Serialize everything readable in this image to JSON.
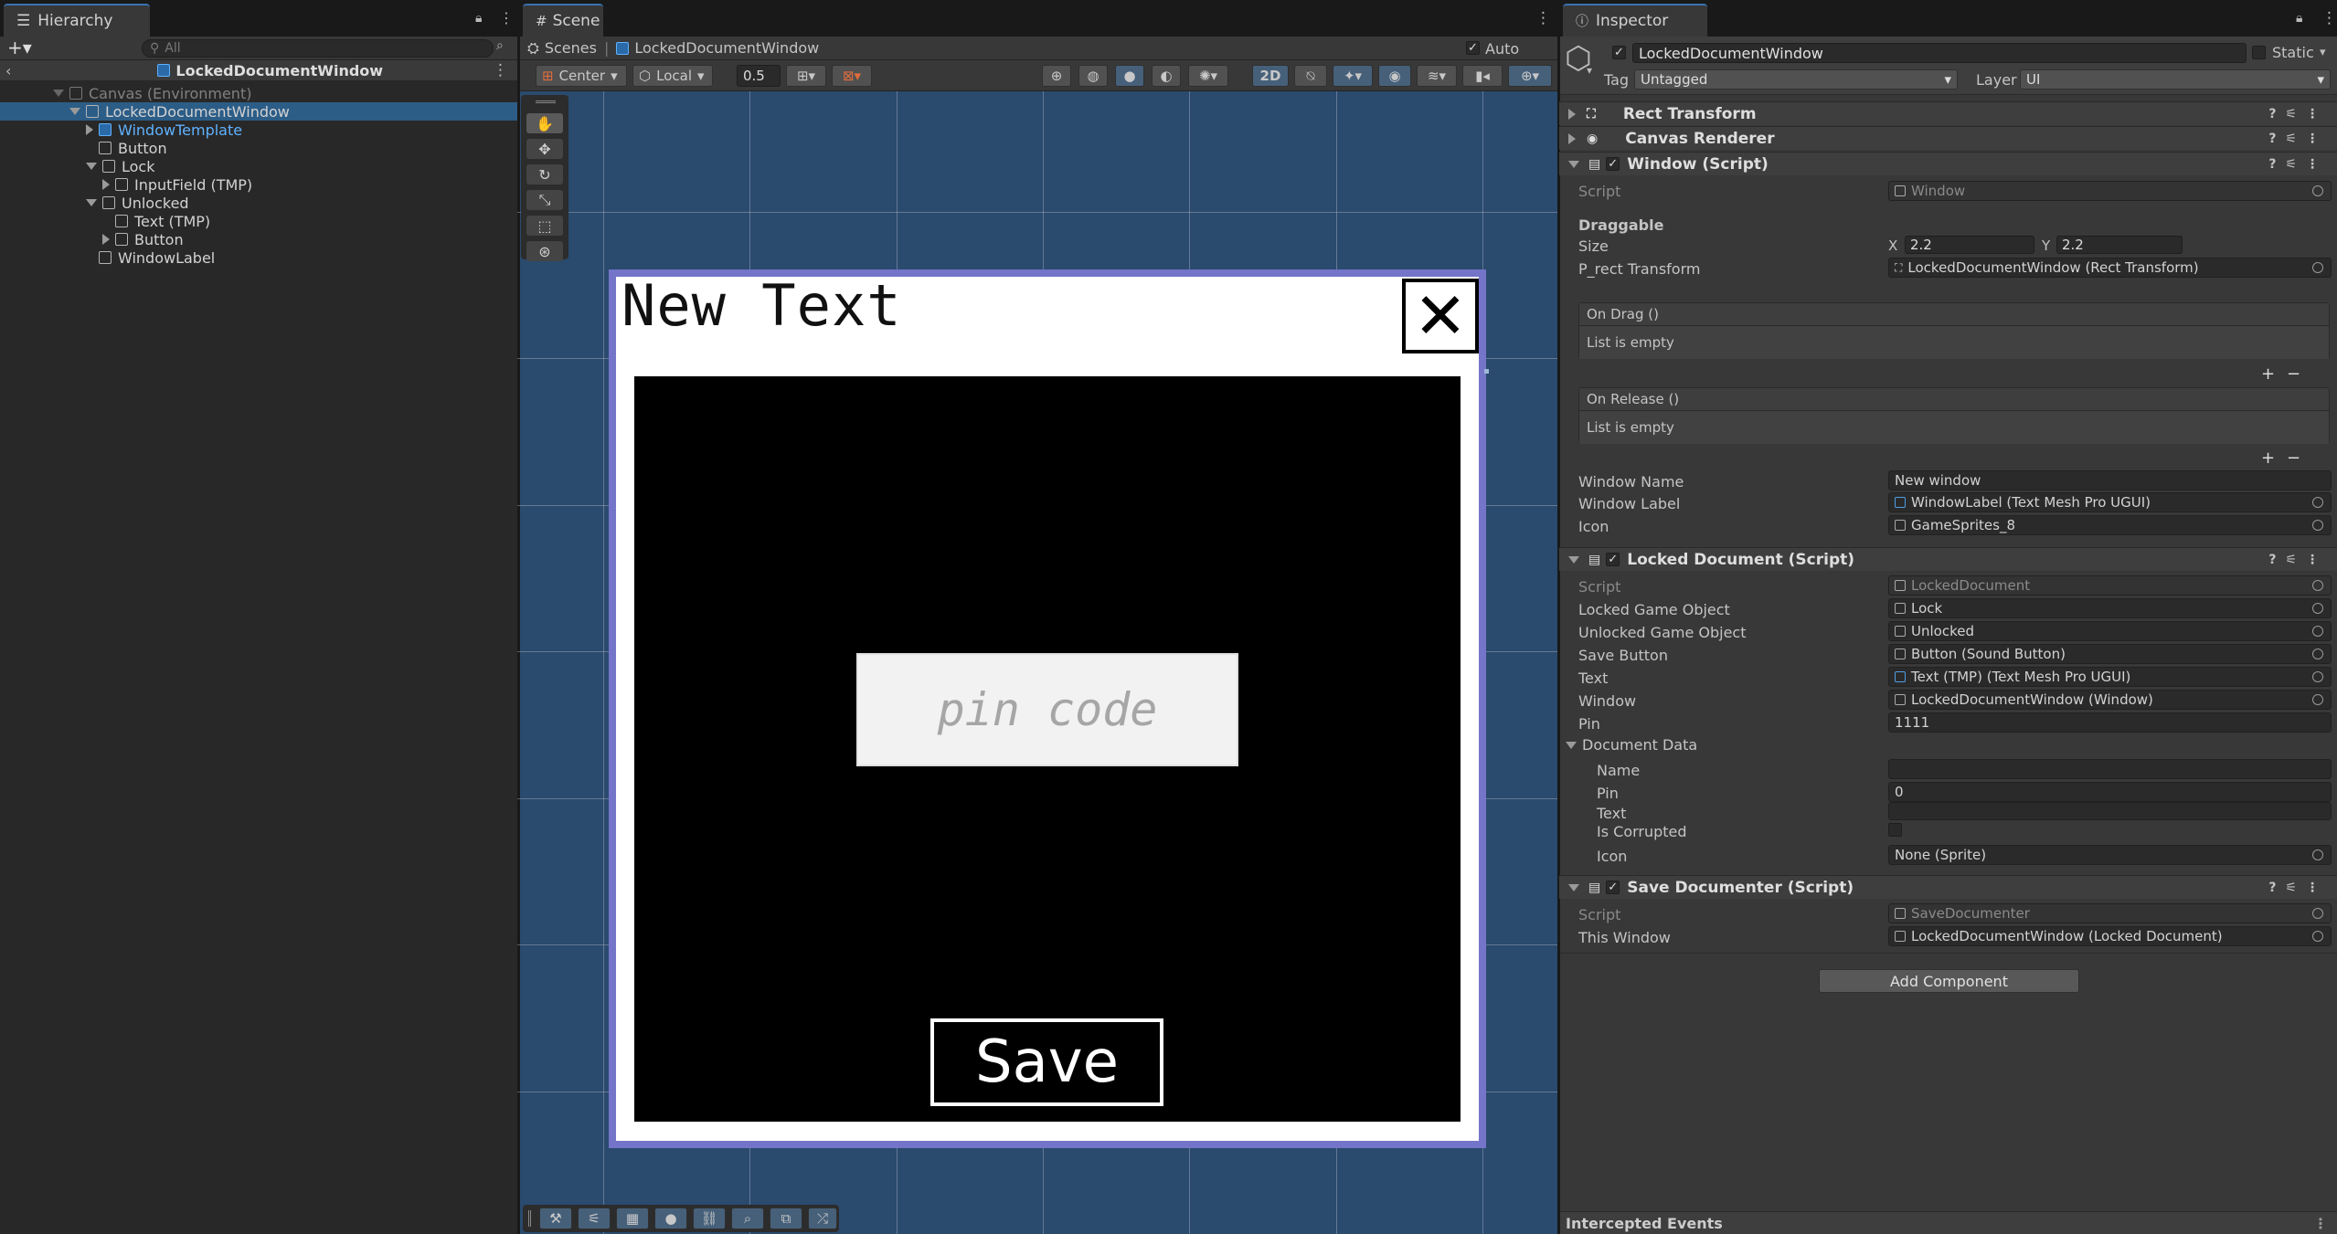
{
  "hierarchy": {
    "tab": "Hierarchy",
    "search_placeholder": "All",
    "scene_title": "LockedDocumentWindow",
    "items": [
      {
        "label": "Canvas (Environment)"
      },
      {
        "label": "LockedDocumentWindow"
      },
      {
        "label": "WindowTemplate"
      },
      {
        "label": "Button"
      },
      {
        "label": "Lock"
      },
      {
        "label": "InputField (TMP)"
      },
      {
        "label": "Unlocked"
      },
      {
        "label": "Text (TMP)"
      },
      {
        "label": "Button"
      },
      {
        "label": "WindowLabel"
      }
    ]
  },
  "scene": {
    "tab": "Scene",
    "breadcrumb_root": "Scenes",
    "breadcrumb_item": "LockedDocumentWindow",
    "auto_save": "Auto Save",
    "pivot": "Center",
    "space": "Local",
    "snap_value": "0.5",
    "mode_2d": "2D",
    "window": {
      "title": "New Text",
      "pin_placeholder": "pin code",
      "save_label": "Save"
    }
  },
  "inspector": {
    "tab": "Inspector",
    "object_name": "LockedDocumentWindow",
    "static_label": "Static",
    "tag_label": "Tag",
    "tag_value": "Untagged",
    "layer_label": "Layer",
    "layer_value": "UI",
    "components": {
      "rect_transform": "Rect Transform",
      "canvas_renderer": "Canvas Renderer",
      "window_script": "Window (Script)",
      "locked_doc": "Locked Document (Script)",
      "save_doc": "Save Documenter (Script)"
    },
    "window": {
      "script_label": "Script",
      "script_value": "Window",
      "draggable": "Draggable",
      "size_label": "Size",
      "size_x_label": "X",
      "size_x": "2.2",
      "size_y_label": "Y",
      "size_y": "2.2",
      "prect_label": "P_rect Transform",
      "prect_value": "LockedDocumentWindow (Rect Transform)",
      "on_drag": "On Drag ()",
      "on_release": "On Release ()",
      "list_empty": "List is empty",
      "window_name_label": "Window Name",
      "window_name_value": "New window",
      "window_label_label": "Window Label",
      "window_label_value": "WindowLabel (Text Mesh Pro UGUI)",
      "icon_label": "Icon",
      "icon_value": "GameSprites_8"
    },
    "locked": {
      "script_label": "Script",
      "script_value": "LockedDocument",
      "locked_go_label": "Locked Game Object",
      "locked_go_value": "Lock",
      "unlocked_go_label": "Unlocked Game Object",
      "unlocked_go_value": "Unlocked",
      "save_button_label": "Save Button",
      "save_button_value": "Button (Sound Button)",
      "text_label": "Text",
      "text_value": "Text (TMP) (Text Mesh Pro UGUI)",
      "window_label": "Window",
      "window_value": "LockedDocumentWindow (Window)",
      "pin_label": "Pin",
      "pin_value": "1111",
      "doc_data": "Document Data",
      "dd_name_label": "Name",
      "dd_name_value": "",
      "dd_pin_label": "Pin",
      "dd_pin_value": "0",
      "dd_text_label": "Text",
      "dd_text_value": "",
      "dd_corrupted_label": "Is Corrupted",
      "dd_icon_label": "Icon",
      "dd_icon_value": "None (Sprite)"
    },
    "save": {
      "script_label": "Script",
      "script_value": "SaveDocumenter",
      "this_window_label": "This Window",
      "this_window_value": "LockedDocumentWindow (Locked Document)"
    },
    "add_component": "Add Component",
    "intercepted_events": "Intercepted Events"
  }
}
